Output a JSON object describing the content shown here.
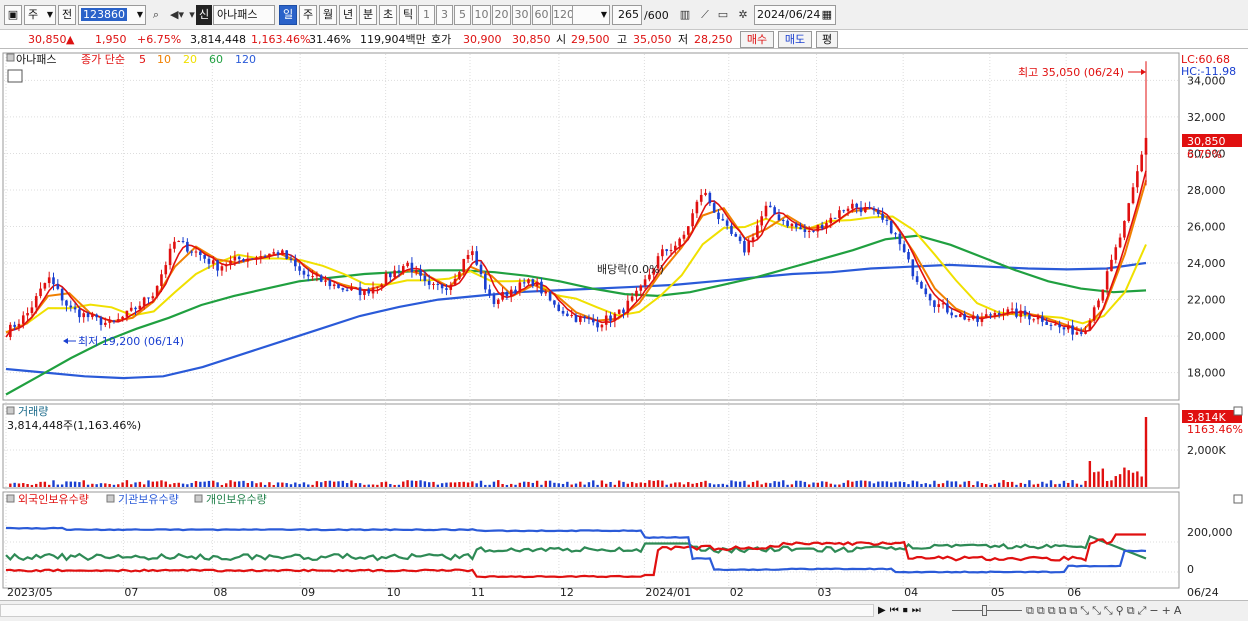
{
  "toolbar": {
    "period_type": "주",
    "adj": "전",
    "code": "123860",
    "market_badge": "신",
    "stock_name": "아나패스",
    "intervals": [
      "일",
      "주",
      "월",
      "년",
      "분",
      "초",
      "틱"
    ],
    "selected_interval": "일",
    "minute_options": [
      "1",
      "3",
      "5",
      "10",
      "20",
      "30",
      "60",
      "120"
    ],
    "count": "265",
    "count_max": "/600",
    "date": "2024/06/24"
  },
  "quote": {
    "price": "30,850",
    "arrow": "▲",
    "change": "1,950",
    "change_pct": "+6.75%",
    "volume": "3,814,448",
    "volume_ratio": "1,163.46%",
    "turnover": "31.46%",
    "amount": "119,904백만",
    "hoga_label": "호가",
    "ask": "30,900",
    "bid": "30,850",
    "open_label": "시",
    "open": "29,500",
    "high_label": "고",
    "high": "35,050",
    "low_label": "저",
    "low": "28,250",
    "buy_btn": "매수",
    "sell_btn": "매도",
    "eval_btn": "평"
  },
  "colors": {
    "up": "#e01010",
    "down": "#1a3fd0",
    "ma5": "#e01010",
    "ma10": "#f08000",
    "ma20": "#f0e000",
    "ma60": "#20a040",
    "ma120": "#2a5ad8"
  },
  "price_panel": {
    "legend_name": "아나패스",
    "legend_text": "종가 단순",
    "ma_periods": [
      "5",
      "10",
      "20",
      "60",
      "120"
    ],
    "lc": "LC:60.68",
    "hc": "HC:-11.98",
    "high_note": "최고 35,050 (06/24)",
    "low_note": "최저 19,200 (06/14)",
    "dividend_note": "배당락(0.0%)",
    "last_price": "30,850",
    "last_pct": "6.75%",
    "yticks": [
      "34,000",
      "32,000",
      "30,000",
      "28,000",
      "26,000",
      "24,000",
      "22,000",
      "20,000",
      "18,000"
    ]
  },
  "volume_panel": {
    "title": "거래량",
    "value": "3,814,448주(1,163.46%)",
    "last_value": "3,814K",
    "last_pct": "1163.46%",
    "ytick": "2,000K"
  },
  "holding_panel": {
    "foreign": "외국인보유수량",
    "inst": "기관보유수량",
    "indiv": "개인보유수량",
    "yticks": [
      "200,000",
      "0"
    ]
  },
  "x_axis": {
    "labels": [
      "2023/05",
      "07",
      "08",
      "09",
      "10",
      "11",
      "12",
      "2024/01",
      "02",
      "03",
      "04",
      "05",
      "06"
    ],
    "last_date": "06/24"
  },
  "chart_data": {
    "type": "candlestick",
    "title": "아나패스",
    "ylim": [
      16500,
      35500
    ],
    "closes_weekly": [
      20200,
      21200,
      23200,
      21500,
      21000,
      20600,
      21400,
      22400,
      25200,
      24600,
      23800,
      24200,
      24400,
      24600,
      23400,
      23000,
      22600,
      22400,
      23200,
      24000,
      22600,
      22800,
      24800,
      21800,
      22600,
      23000,
      21600,
      21000,
      20700,
      21200,
      22400,
      24500,
      25200,
      28000,
      26000,
      24700,
      27000,
      26200,
      25600,
      26400,
      27200,
      26800,
      25800,
      23400,
      21800,
      21200,
      20800,
      21400,
      21200,
      21000,
      20400,
      20200,
      22800,
      26200,
      30850
    ],
    "ma60_weekly": [
      16800,
      17800,
      18800,
      19700,
      20400,
      21000,
      21700,
      22200,
      22600,
      23000,
      23200,
      23400,
      23500,
      23600,
      23600,
      23500,
      23300,
      23000,
      22600,
      22300,
      22200,
      22400,
      22800,
      23200,
      23700,
      24200,
      24700,
      25300,
      25500,
      25000,
      24300,
      23600,
      23000,
      22600,
      22400,
      22500
    ],
    "ma120_weekly": [
      18200,
      18000,
      17800,
      17700,
      17800,
      18300,
      19000,
      19700,
      20400,
      21100,
      21600,
      22000,
      22200,
      22400,
      22500,
      22600,
      22700,
      22800,
      23000,
      23200,
      23400,
      23500,
      23700,
      23800,
      23900,
      23800,
      23700,
      23650,
      23700,
      24000
    ],
    "volume_spikes": [
      {
        "date": "06/24",
        "value": 3814448
      }
    ],
    "holding_series": [
      {
        "name": "외국인보유수량"
      },
      {
        "name": "기관보유수량"
      },
      {
        "name": "개인보유수량"
      }
    ]
  }
}
